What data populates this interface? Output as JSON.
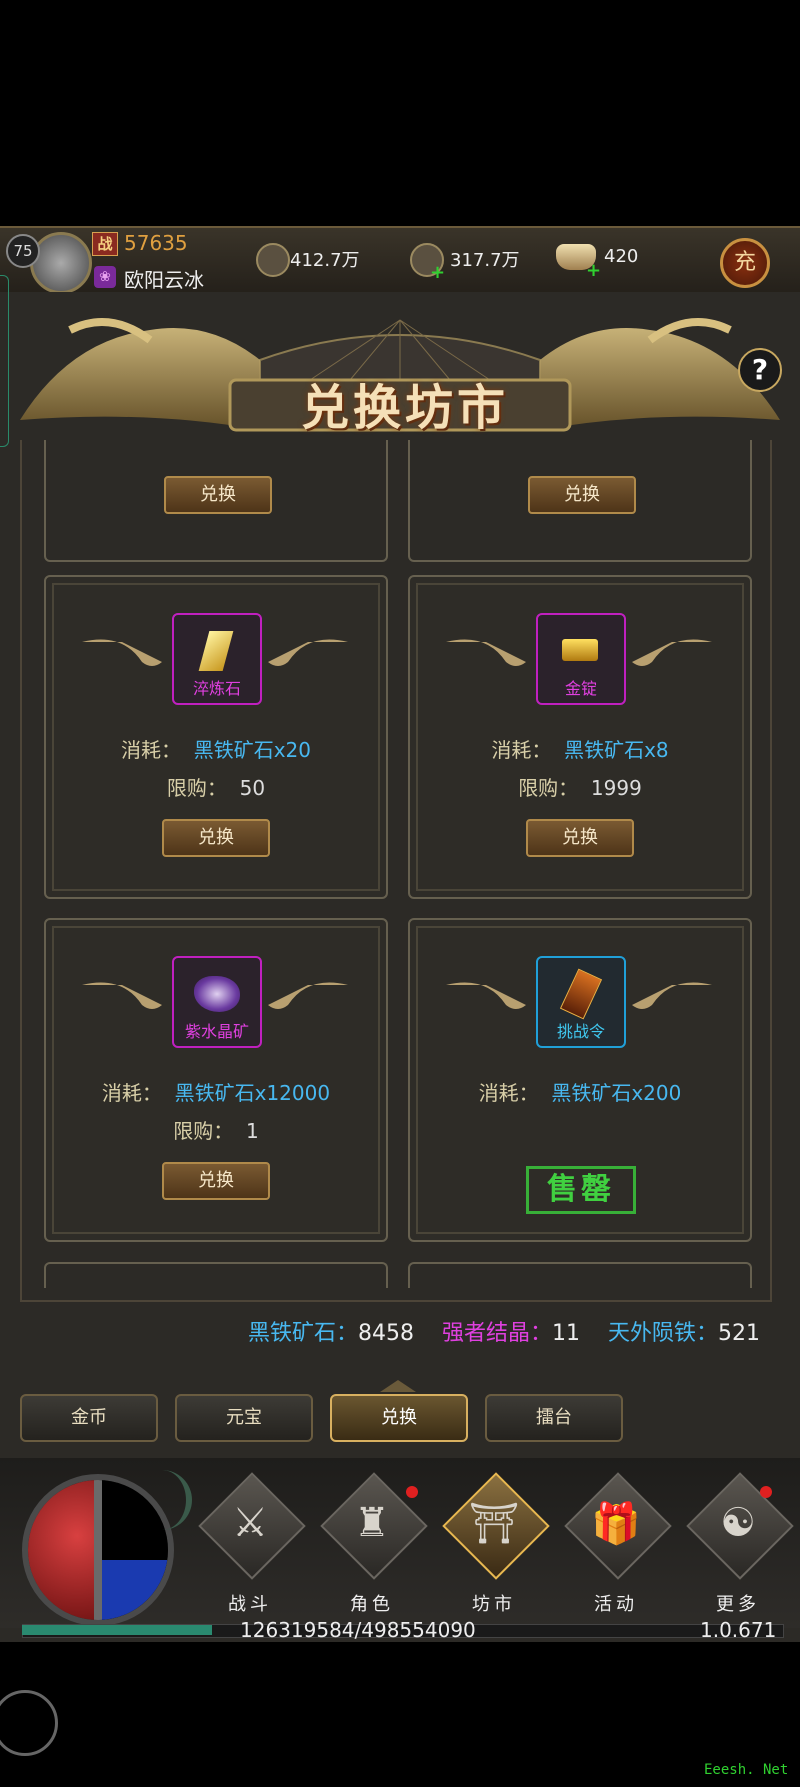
{
  "player": {
    "level": "75",
    "power": "57635",
    "power_badge": "战",
    "name": "欧阳云冰"
  },
  "currencies": [
    {
      "icon": "coin-bag-icon",
      "value": "412.7万"
    },
    {
      "icon": "copper-coin-icon",
      "value": "317.7万"
    },
    {
      "icon": "gold-ingot-icon",
      "value": "420"
    }
  ],
  "recharge_label": "充",
  "title": "兑换坊市",
  "help_label": "?",
  "exchange_label": "兑换",
  "cost_label": "消耗：",
  "limit_label": "限购：",
  "items": [
    {
      "name": "淬炼石",
      "cost": "黑铁矿石x20",
      "limit": "50",
      "state": "exchange"
    },
    {
      "name": "金锭",
      "cost": "黑铁矿石x8",
      "limit": "1999",
      "state": "exchange"
    },
    {
      "name": "紫水晶矿",
      "cost": "黑铁矿石x12000",
      "limit": "1",
      "state": "exchange"
    },
    {
      "name": "挑战令",
      "cost": "黑铁矿石x200",
      "limit": "",
      "state": "soldout"
    }
  ],
  "soldout_label": "售罄",
  "resources": [
    {
      "label": "黑铁矿石：",
      "value": "8458",
      "color": "#48b8f0"
    },
    {
      "label": "强者结晶：",
      "value": "11",
      "color": "#e040e0"
    },
    {
      "label": "天外陨铁：",
      "value": "521",
      "color": "#48b8f0"
    }
  ],
  "tabs": [
    "金币",
    "元宝",
    "兑换",
    "擂台"
  ],
  "active_tab": "兑换",
  "nav": [
    {
      "label": "战斗",
      "icon": "crossed-swords-icon"
    },
    {
      "label": "角色",
      "icon": "helmet-icon"
    },
    {
      "label": "坊市",
      "icon": "market-icon"
    },
    {
      "label": "活动",
      "icon": "gift-icon"
    },
    {
      "label": "更多",
      "icon": "more-icon"
    }
  ],
  "experience": "126319584/498554090",
  "experience_fraction": 0.253,
  "version": "1.0.671",
  "watermark": "Eeesh. Net"
}
